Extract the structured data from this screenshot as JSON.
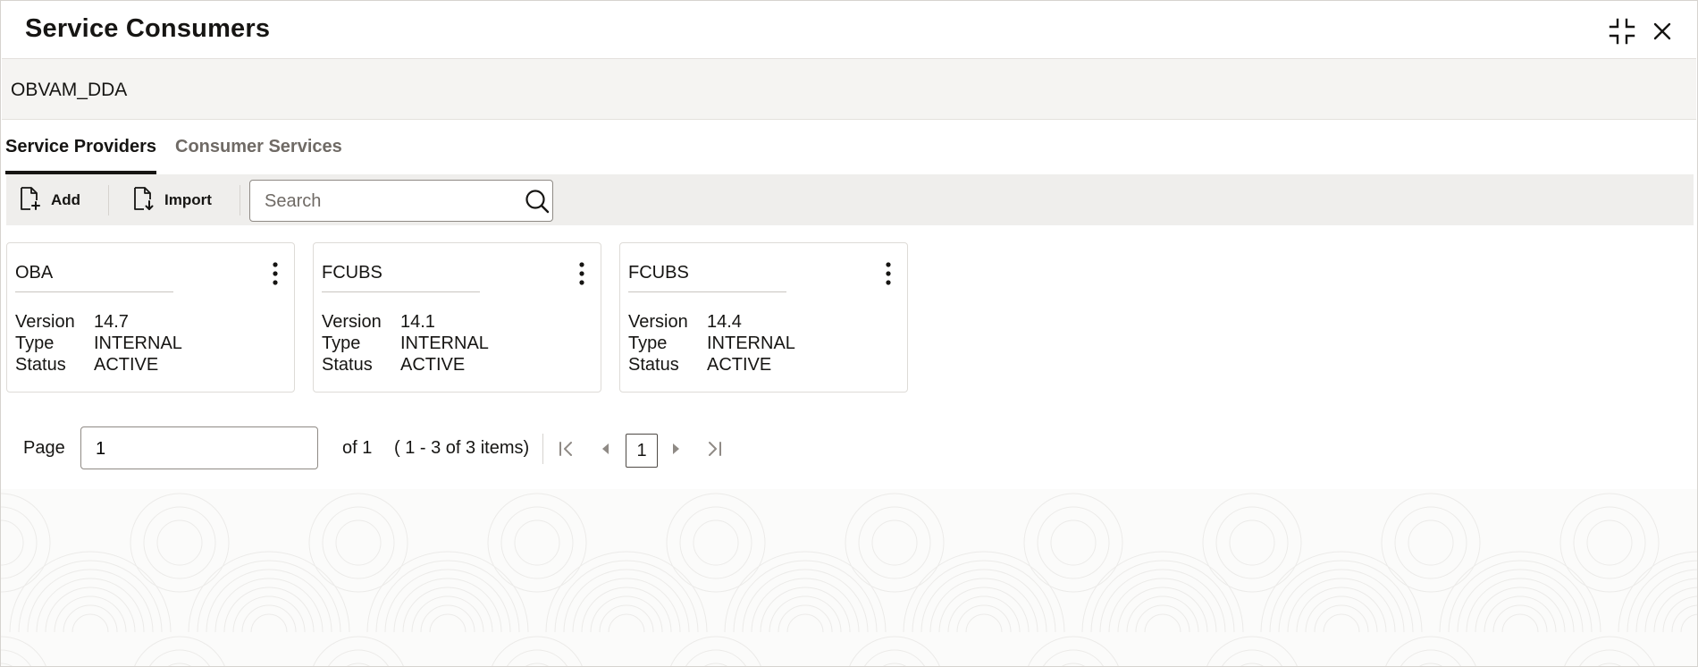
{
  "window": {
    "title": "Service Consumers",
    "collapse_icon": "collapse-icon",
    "close_icon": "close-icon"
  },
  "context": {
    "label": "OBVAM_DDA"
  },
  "tabs": [
    {
      "label": "Service Providers",
      "active": true
    },
    {
      "label": "Consumer Services",
      "active": false
    }
  ],
  "toolbar": {
    "add_label": "Add",
    "import_label": "Import",
    "search_placeholder": "Search"
  },
  "cards": [
    {
      "name": "OBA",
      "version_label": "Version",
      "version": "14.7",
      "type_label": "Type",
      "type": "INTERNAL",
      "status_label": "Status",
      "status": "ACTIVE"
    },
    {
      "name": "FCUBS",
      "version_label": "Version",
      "version": "14.1",
      "type_label": "Type",
      "type": "INTERNAL",
      "status_label": "Status",
      "status": "ACTIVE"
    },
    {
      "name": "FCUBS",
      "version_label": "Version",
      "version": "14.4",
      "type_label": "Type",
      "type": "INTERNAL",
      "status_label": "Status",
      "status": "ACTIVE"
    }
  ],
  "pagination": {
    "page_label": "Page",
    "page_value": "1",
    "of_text": "of 1",
    "items_text": "( 1 - 3 of 3 items)",
    "current_page": "1"
  },
  "colors": {
    "text": "#161513",
    "toolbar_bg": "#efeeec",
    "context_bg": "#f5f4f2",
    "muted": "#6f6a65"
  }
}
